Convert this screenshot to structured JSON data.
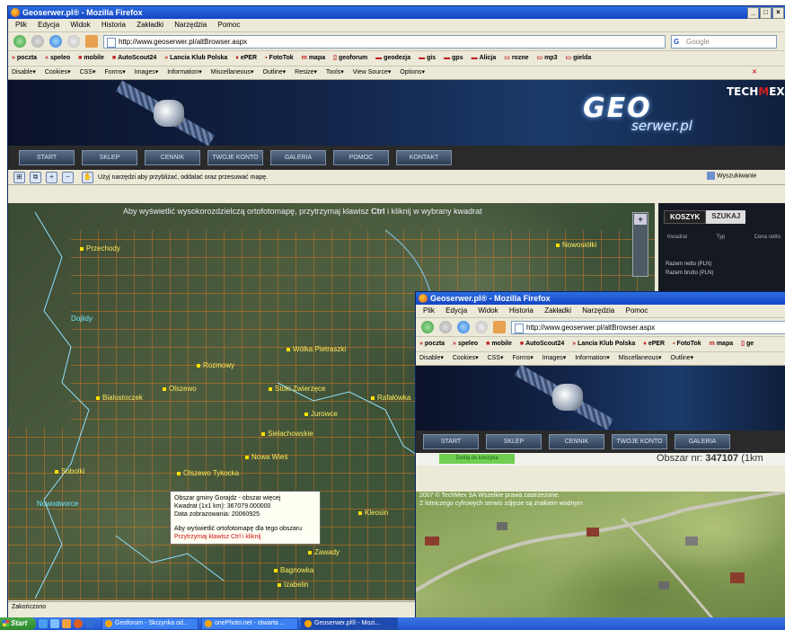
{
  "main": {
    "title": "Geoserwer.pl® - Mozilla Firefox",
    "window_buttons": [
      "_",
      "□",
      "×"
    ],
    "menu": [
      "Plik",
      "Edycja",
      "Widok",
      "Historia",
      "Zakładki",
      "Narzędzia",
      "Pomoc"
    ],
    "url": "http://www.geoserwer.pl/altBrowser.aspx",
    "search_placeholder": "Google",
    "bookmarks": [
      "poczta",
      "speleo",
      "mobile",
      "AutoScout24",
      "Lancia Klub Polska",
      "ePER",
      "FotoTok",
      "mapa",
      "geoforum",
      "geodezja",
      "gis",
      "gps",
      "Alicja",
      "rozne",
      "mp3",
      "gielda"
    ],
    "devbar": [
      "Disable▾",
      "Cookies▾",
      "CSS▾",
      "Forms▾",
      "Images▾",
      "Information▾",
      "Miscellaneous▾",
      "Outline▾",
      "Resize▾",
      "Tools▾",
      "View Source▾",
      "Options▾"
    ],
    "site": {
      "logo_geo": "GEO",
      "logo_serwer": "serwer.pl",
      "logo_tech": "TECH",
      "logo_tech_suffix": "EX",
      "menu": [
        "START",
        "SKLEP",
        "CENNIK",
        "TWOJE KONTO",
        "GALERIA",
        "POMOC",
        "KONTAKT"
      ],
      "tool_hint": "Użyj narzędzi aby przybliżać, oddalać oraz przesuwać mapę.",
      "search_label": "Wyszukiwanie",
      "map_hint_pre": "Aby wyświetlić wysokorozdzielczą ortofotomapę, przytrzymaj klawisz ",
      "map_hint_key": "Ctrl",
      "map_hint_post": " i kliknij w wybrany kwadrat",
      "cart_tab": "KOSZYK",
      "cart_tab2": "SZUKAJ",
      "cart_cols": [
        "Kwadrat",
        "Typ",
        "Cena netto"
      ],
      "cart_lines": [
        "Razem netto (PLN)",
        "Razem brutto (PLN)"
      ],
      "places": [
        "Przechody",
        "Dojlidy",
        "Wólka Pietraszki",
        "Rozmowy",
        "Bialostoczek",
        "Olszewo",
        "Stoki Zwierzęce",
        "Nowosiółki",
        "Jurowce",
        "Sielachowskie",
        "Sobolki",
        "Nowa Wieś",
        "Olszewo Tykocka",
        "Rafałówka",
        "Nowodworce",
        "Zawady",
        "Bagnowka",
        "Izabelin",
        "Kleosin"
      ],
      "tooltip_lines": [
        "Obszar gminy Gorajdz - obszar więcej",
        "Kwadrat (1x1 km): 367079.000000",
        "Data zobrazowania: 20060925",
        "",
        "Aby wyświetlić ortofotomapę dla tego obszaru"
      ],
      "tooltip_red": "Przytrzymaj klawisz Ctrl i kliknij",
      "status": "Zakończono"
    }
  },
  "second": {
    "title": "Geoserwer.pl® - Mozilla Firefox",
    "menu": [
      "Plik",
      "Edycja",
      "Widok",
      "Historia",
      "Zakładki",
      "Narzędzia",
      "Pomoc"
    ],
    "url": "http://www.geoserwer.pl/altBrowser.aspx",
    "bookmarks": [
      "poczta",
      "speleo",
      "mobile",
      "AutoScout24",
      "Lancia Klub Polska",
      "ePER",
      "FotoTok",
      "mapa",
      "ge"
    ],
    "devbar": [
      "Disable▾",
      "Cookies▾",
      "CSS▾",
      "Forms▾",
      "Images▾",
      "Information▾",
      "Miscellaneous▾",
      "Outline▾"
    ],
    "menu_site": [
      "START",
      "SKLEP",
      "CENNIK",
      "TWOJE KONTO",
      "GALERIA"
    ],
    "area_label": "Obszar nr:",
    "area_number": "347107",
    "area_suffix": "(1km",
    "green_button": "Dodaj do koszyka",
    "copyright_1": "2007 © TechMex SA Wszelkie prawa zastrzeżone.",
    "copyright_2": "Z lotniczego cyfrowych serwis zdjęcie są znakiem wodnym"
  },
  "taskbar": {
    "start": "Start",
    "buttons": [
      "Geoforum - Skrzynka od...",
      "onePhoto.net - otwarta ...",
      "Geoserwer.pl® - Mozi..."
    ]
  }
}
